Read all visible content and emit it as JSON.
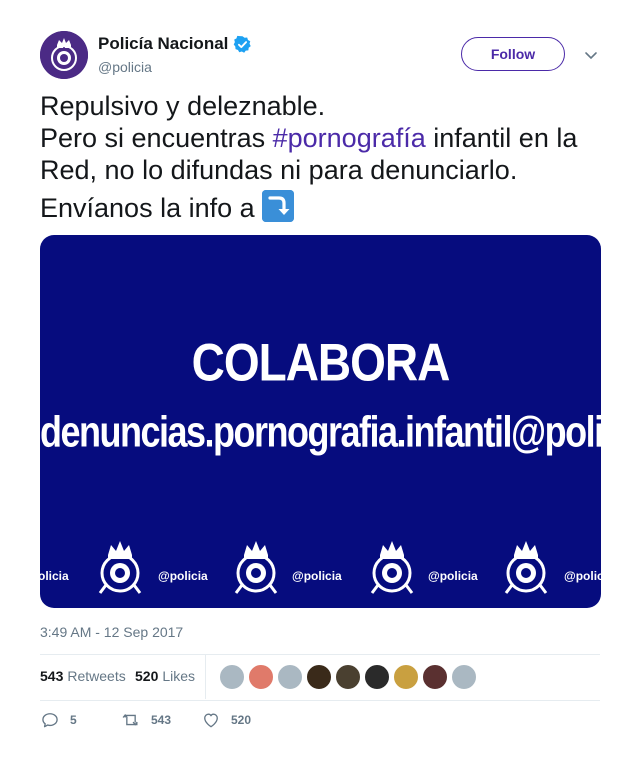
{
  "author": {
    "name": "Policía Nacional",
    "handle": "@policia",
    "verified": true,
    "avatar_color": "#4b2a85"
  },
  "follow_button": {
    "label": "Follow",
    "color": "#4b2aa8"
  },
  "tweet": {
    "line1": "Repulsivo y deleznable.",
    "line2_prefix": "Pero si encuentras ",
    "hashtag": "#pornografía",
    "line2_suffix": " infantil en la",
    "line3": "Red, no lo difundas ni para denunciarlo.",
    "line4": "Envíanos la info a ",
    "emoji": "right-arrow-curving-down-icon"
  },
  "media": {
    "background": "#060c7e",
    "headline": "COLABORA",
    "email": "denuncias.pornografia.infantil@policia.es",
    "watermark": "@policia"
  },
  "timestamp": "3:49 AM - 12 Sep 2017",
  "stats": {
    "retweets_count": "543",
    "retweets_label": "Retweets",
    "likes_count": "520",
    "likes_label": "Likes"
  },
  "likers": [
    {
      "color": "#aab8c2"
    },
    {
      "color": "#e07a6a"
    },
    {
      "color": "#aab8c2"
    },
    {
      "color": "#3a2a1a"
    },
    {
      "color": "#4a4030"
    },
    {
      "color": "#2a2a2a"
    },
    {
      "color": "#c9a040"
    },
    {
      "color": "#5a3030"
    },
    {
      "color": "#aab8c2"
    }
  ],
  "actions": {
    "reply_count": "5",
    "retweet_count": "543",
    "like_count": "520"
  }
}
